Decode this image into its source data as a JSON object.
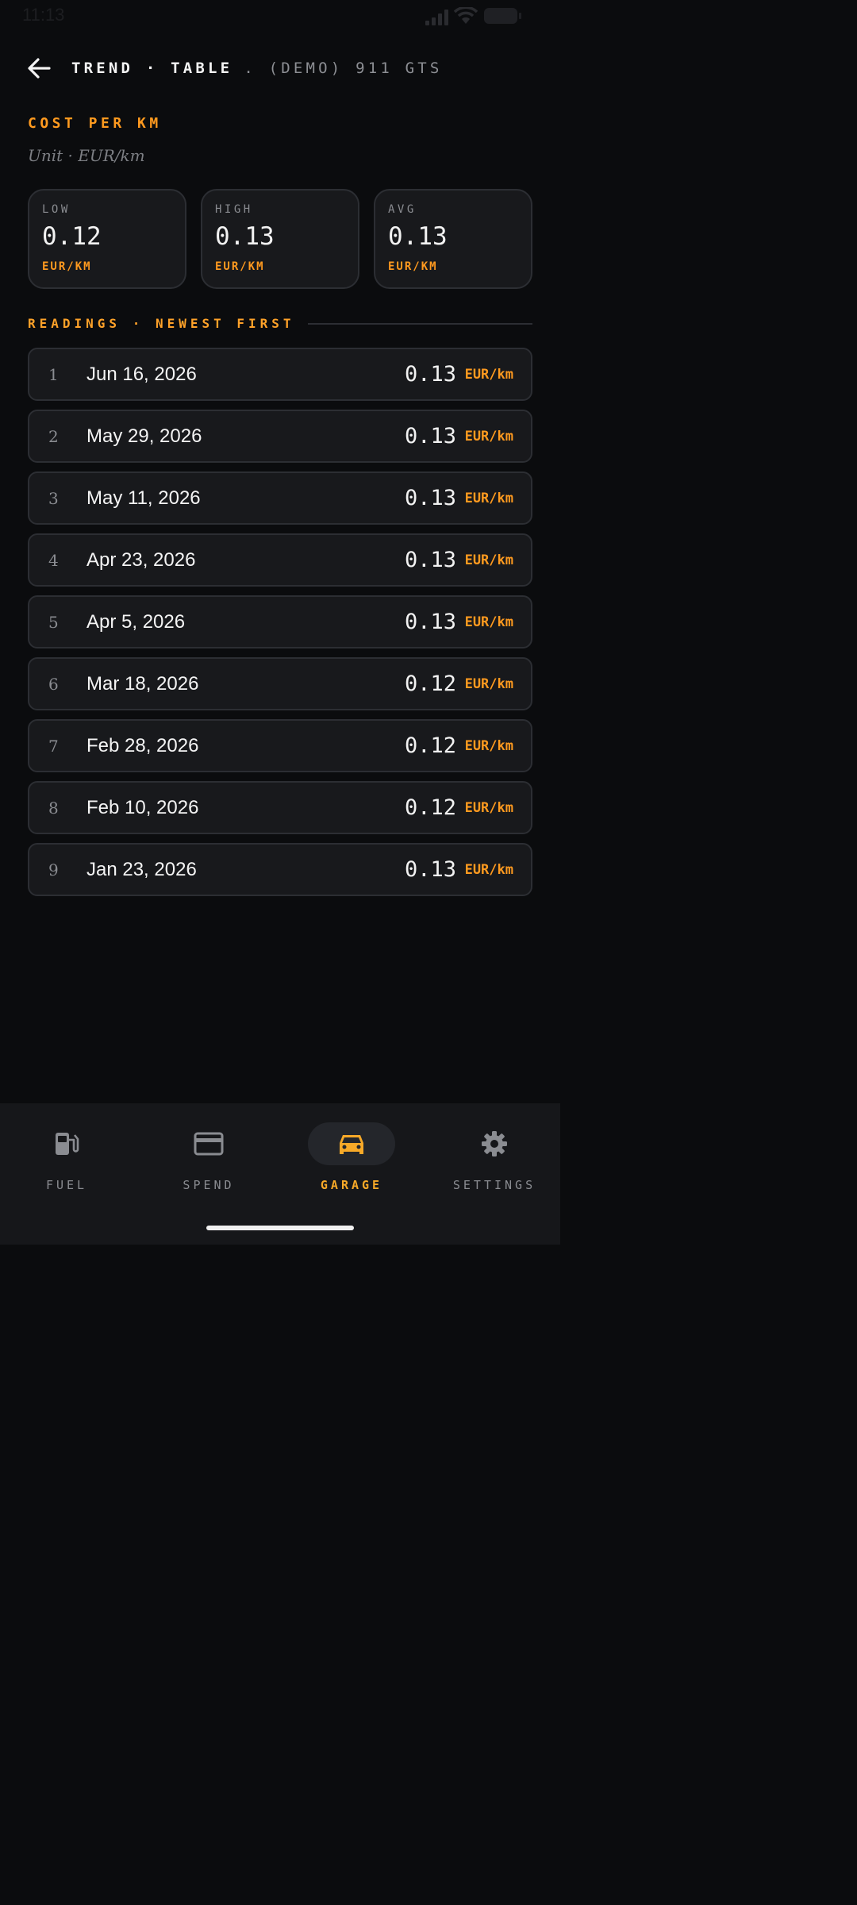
{
  "status_bar": {
    "time": "11:13"
  },
  "header": {
    "title": "TREND · TABLE",
    "subtitle": ". (DEMO) 911 GTS"
  },
  "metric": {
    "title": "COST PER KM",
    "unit_note": "Unit · EUR/km"
  },
  "stats": [
    {
      "label": "LOW",
      "value": "0.12",
      "unit": "EUR/KM"
    },
    {
      "label": "HIGH",
      "value": "0.13",
      "unit": "EUR/KM"
    },
    {
      "label": "AVG",
      "value": "0.13",
      "unit": "EUR/KM"
    }
  ],
  "readings": {
    "heading": "READINGS · NEWEST FIRST",
    "rows": [
      {
        "index": "1",
        "date": "Jun 16, 2026",
        "value": "0.13",
        "unit": "EUR/km"
      },
      {
        "index": "2",
        "date": "May 29, 2026",
        "value": "0.13",
        "unit": "EUR/km"
      },
      {
        "index": "3",
        "date": "May 11, 2026",
        "value": "0.13",
        "unit": "EUR/km"
      },
      {
        "index": "4",
        "date": "Apr 23, 2026",
        "value": "0.13",
        "unit": "EUR/km"
      },
      {
        "index": "5",
        "date": "Apr 5, 2026",
        "value": "0.13",
        "unit": "EUR/km"
      },
      {
        "index": "6",
        "date": "Mar 18, 2026",
        "value": "0.12",
        "unit": "EUR/km"
      },
      {
        "index": "7",
        "date": "Feb 28, 2026",
        "value": "0.12",
        "unit": "EUR/km"
      },
      {
        "index": "8",
        "date": "Feb 10, 2026",
        "value": "0.12",
        "unit": "EUR/km"
      },
      {
        "index": "9",
        "date": "Jan 23, 2026",
        "value": "0.13",
        "unit": "EUR/km"
      }
    ]
  },
  "nav": {
    "items": [
      {
        "label": "FUEL",
        "icon": "fuel-pump-icon"
      },
      {
        "label": "SPEND",
        "icon": "credit-card-icon"
      },
      {
        "label": "GARAGE",
        "icon": "car-icon",
        "active": true
      },
      {
        "label": "SETTINGS",
        "icon": "gear-icon"
      }
    ]
  },
  "colors": {
    "accent": "#ff9a1f",
    "background": "#0b0c0e",
    "card": "#18191c",
    "active_nav": "#f7a928"
  }
}
